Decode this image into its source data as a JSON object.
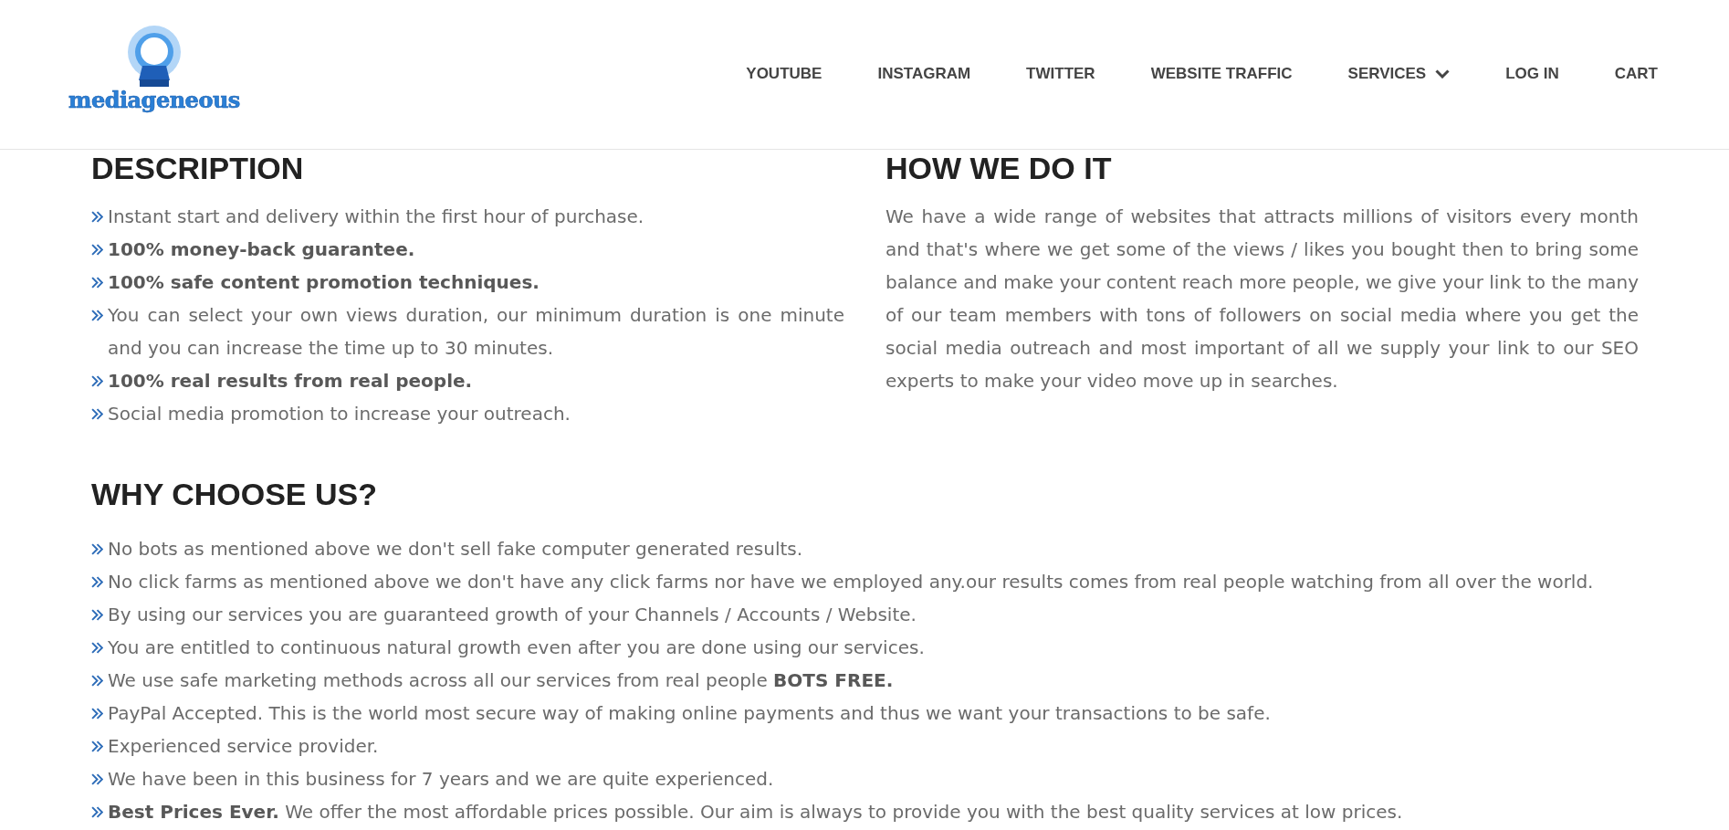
{
  "header": {
    "logo_text": "mediageneous",
    "nav": [
      {
        "label": "YOUTUBE",
        "kind": "link"
      },
      {
        "label": "INSTAGRAM",
        "kind": "link"
      },
      {
        "label": "TWITTER",
        "kind": "link"
      },
      {
        "label": "WEBSITE TRAFFIC",
        "kind": "link"
      },
      {
        "label": "SERVICES",
        "kind": "dropdown"
      },
      {
        "label": "LOG IN",
        "kind": "link"
      },
      {
        "label": "CART",
        "kind": "link"
      }
    ]
  },
  "description": {
    "heading": "DESCRIPTION",
    "items": [
      {
        "text": "Instant start and delivery within the first hour of purchase.",
        "bold": false
      },
      {
        "text": "100% money-back guarantee.",
        "bold": true
      },
      {
        "text": "100% safe content promotion techniques.",
        "bold": true
      },
      {
        "text": "You can select your own views duration, our minimum duration is one minute and you can increase the time up to 30 minutes.",
        "bold": false
      },
      {
        "text": "100% real results from real people.",
        "bold": true
      },
      {
        "text": "Social media promotion to increase your outreach.",
        "bold": false
      }
    ]
  },
  "how_we_do_it": {
    "heading": "HOW WE DO IT",
    "text": "We have a wide range of websites that attracts millions of visitors every month and that's where we get some of the views / likes you bought then to bring some balance and make your content reach more people, we give your link to the many of our team members with tons of followers on social media where you get the social media outreach and most important of all we supply your link to our SEO experts to make your video move up in searches."
  },
  "why_choose_us": {
    "heading": "WHY CHOOSE US?",
    "items": [
      "No bots as mentioned above we don't sell fake computer generated results.",
      "No click farms as mentioned above we don't have any click farms nor have we employed any.our results comes from real people watching from all over the world.",
      "By using our services you are guaranteed growth of your Channels / Accounts / Website.",
      "You are entitled to continuous natural growth even after you are done using our services.",
      "We use safe marketing methods across all our services from real people **BOTS FREE.**",
      "PayPal Accepted. This is the world most secure way of making online payments and thus we want your transactions to be safe.",
      "Experienced service provider.",
      "We have been in this business for 7 years and we are quite experienced.",
      "**Best Prices Ever.** We offer the most affordable prices possible. Our aim is always to provide you with the best quality services at low prices."
    ]
  }
}
